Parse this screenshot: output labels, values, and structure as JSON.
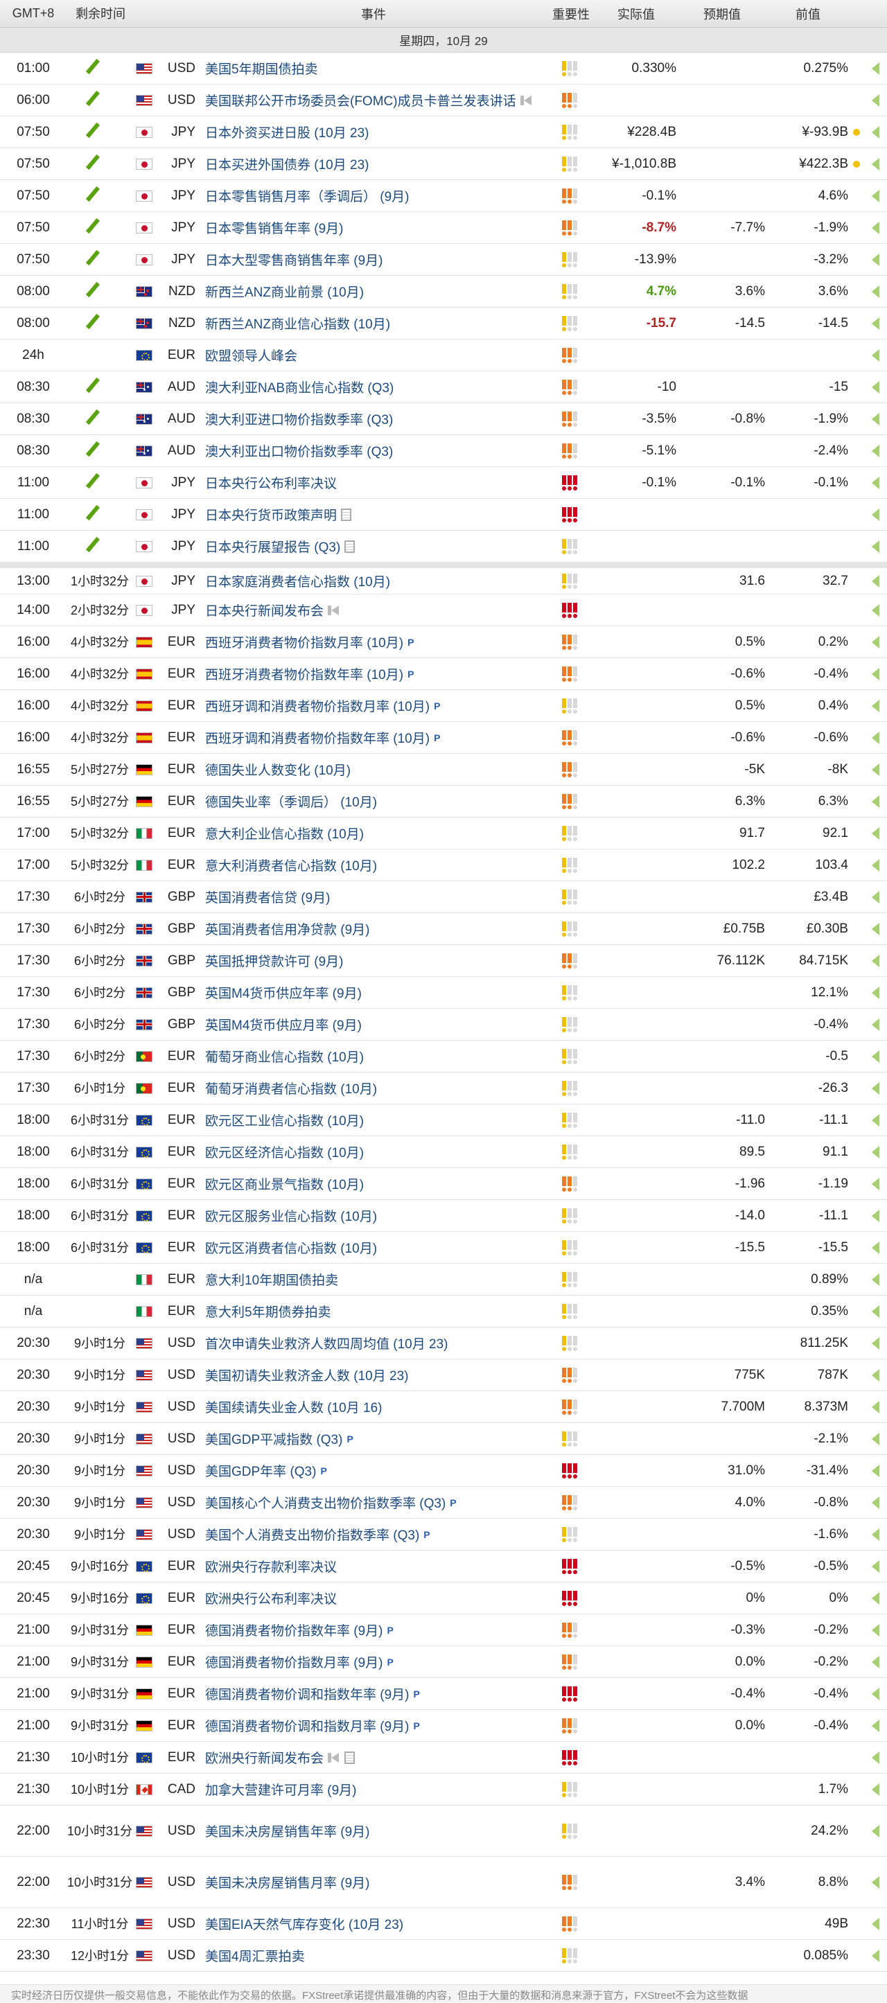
{
  "header": {
    "timezone": "GMT+8",
    "remaining": "剩余时间",
    "event": "事件",
    "importance": "重要性",
    "actual": "实际值",
    "consensus": "预期值",
    "previous": "前值"
  },
  "date_label": "星期四，10月 29",
  "importance_colors": {
    "low": "#f0c000",
    "medium": "#ef7c22",
    "high": "#d0021b",
    "off": "#d8d8d8"
  },
  "footer": "实时经济日历仅提供一般交易信息，不能依此作为交易的依据。FXStreet承诺提供最准确的内容，但由于大量的数据和消息来源于官方，FXStreet不会为这些数据",
  "rows": [
    {
      "time": "01:00",
      "rem": "",
      "done": true,
      "flag": "us",
      "cur": "USD",
      "ev": "美国5年期国债拍卖",
      "icon": "",
      "imp": 1,
      "act": "0.330%",
      "actc": "",
      "cons": "",
      "prev": "0.275%",
      "dot": false
    },
    {
      "time": "06:00",
      "rem": "",
      "done": true,
      "flag": "us",
      "cur": "USD",
      "ev": "美国联邦公开市场委员会(FOMC)成员卡普兰发表讲话",
      "icon": "mega",
      "imp": 2,
      "act": "",
      "actc": "",
      "cons": "",
      "prev": "",
      "dot": false
    },
    {
      "time": "07:50",
      "rem": "",
      "done": true,
      "flag": "jp",
      "cur": "JPY",
      "ev": "日本外资买进日股 (10月 23)",
      "icon": "",
      "imp": 1,
      "act": "¥228.4B",
      "actc": "",
      "cons": "",
      "prev": "¥-93.9B",
      "dot": true
    },
    {
      "time": "07:50",
      "rem": "",
      "done": true,
      "flag": "jp",
      "cur": "JPY",
      "ev": "日本买进外国债券 (10月 23)",
      "icon": "",
      "imp": 1,
      "act": "¥-1,010.8B",
      "actc": "",
      "cons": "",
      "prev": "¥422.3B",
      "dot": true
    },
    {
      "time": "07:50",
      "rem": "",
      "done": true,
      "flag": "jp",
      "cur": "JPY",
      "ev": "日本零售销售月率（季调后） (9月)",
      "icon": "",
      "imp": 2,
      "act": "-0.1%",
      "actc": "",
      "cons": "",
      "prev": "4.6%",
      "dot": false
    },
    {
      "time": "07:50",
      "rem": "",
      "done": true,
      "flag": "jp",
      "cur": "JPY",
      "ev": "日本零售销售年率 (9月)",
      "icon": "",
      "imp": 2,
      "act": "-8.7%",
      "actc": "neg",
      "cons": "-7.7%",
      "prev": "-1.9%",
      "dot": false
    },
    {
      "time": "07:50",
      "rem": "",
      "done": true,
      "flag": "jp",
      "cur": "JPY",
      "ev": "日本大型零售商销售年率 (9月)",
      "icon": "",
      "imp": 1,
      "act": "-13.9%",
      "actc": "",
      "cons": "",
      "prev": "-3.2%",
      "dot": false
    },
    {
      "time": "08:00",
      "rem": "",
      "done": true,
      "flag": "nz",
      "cur": "NZD",
      "ev": "新西兰ANZ商业前景 (10月)",
      "icon": "",
      "imp": 1,
      "act": "4.7%",
      "actc": "pos",
      "cons": "3.6%",
      "prev": "3.6%",
      "dot": false
    },
    {
      "time": "08:00",
      "rem": "",
      "done": true,
      "flag": "nz",
      "cur": "NZD",
      "ev": "新西兰ANZ商业信心指数 (10月)",
      "icon": "",
      "imp": 1,
      "act": "-15.7",
      "actc": "neg",
      "cons": "-14.5",
      "prev": "-14.5",
      "dot": false
    },
    {
      "time": "24h",
      "rem": "",
      "done": false,
      "flag": "eu",
      "cur": "EUR",
      "ev": "欧盟领导人峰会",
      "icon": "",
      "imp": 2,
      "act": "",
      "actc": "",
      "cons": "",
      "prev": "",
      "dot": false
    },
    {
      "time": "08:30",
      "rem": "",
      "done": true,
      "flag": "au",
      "cur": "AUD",
      "ev": "澳大利亚NAB商业信心指数 (Q3)",
      "icon": "",
      "imp": 2,
      "act": "-10",
      "actc": "",
      "cons": "",
      "prev": "-15",
      "dot": false
    },
    {
      "time": "08:30",
      "rem": "",
      "done": true,
      "flag": "au",
      "cur": "AUD",
      "ev": "澳大利亚进口物价指数季率 (Q3)",
      "icon": "",
      "imp": 2,
      "act": "-3.5%",
      "actc": "",
      "cons": "-0.8%",
      "prev": "-1.9%",
      "dot": false
    },
    {
      "time": "08:30",
      "rem": "",
      "done": true,
      "flag": "au",
      "cur": "AUD",
      "ev": "澳大利亚出口物价指数季率 (Q3)",
      "icon": "",
      "imp": 2,
      "act": "-5.1%",
      "actc": "",
      "cons": "",
      "prev": "-2.4%",
      "dot": false
    },
    {
      "time": "11:00",
      "rem": "",
      "done": true,
      "flag": "jp",
      "cur": "JPY",
      "ev": "日本央行公布利率决议",
      "icon": "",
      "imp": 3,
      "act": "-0.1%",
      "actc": "",
      "cons": "-0.1%",
      "prev": "-0.1%",
      "dot": false
    },
    {
      "time": "11:00",
      "rem": "",
      "done": true,
      "flag": "jp",
      "cur": "JPY",
      "ev": "日本央行货币政策声明",
      "icon": "doc",
      "imp": 3,
      "act": "",
      "actc": "",
      "cons": "",
      "prev": "",
      "dot": false
    },
    {
      "time": "11:00",
      "rem": "",
      "done": true,
      "flag": "jp",
      "cur": "JPY",
      "ev": "日本央行展望报告 (Q3)",
      "icon": "doc",
      "imp": 1,
      "act": "",
      "actc": "",
      "cons": "",
      "prev": "",
      "dot": false
    },
    {
      "time": "13:00",
      "rem": "1小时32分",
      "done": false,
      "flag": "jp",
      "cur": "JPY",
      "ev": "日本家庭消费者信心指数 (10月)",
      "icon": "",
      "imp": 1,
      "act": "",
      "actc": "",
      "cons": "31.6",
      "prev": "32.7",
      "dot": false,
      "sep": true
    },
    {
      "time": "14:00",
      "rem": "2小时32分",
      "done": false,
      "flag": "jp",
      "cur": "JPY",
      "ev": "日本央行新闻发布会",
      "icon": "mega",
      "imp": 3,
      "act": "",
      "actc": "",
      "cons": "",
      "prev": "",
      "dot": false
    },
    {
      "time": "16:00",
      "rem": "4小时32分",
      "done": false,
      "flag": "es",
      "cur": "EUR",
      "ev": "西班牙消费者物价指数月率 (10月)",
      "icon": "p",
      "imp": 2,
      "act": "",
      "actc": "",
      "cons": "0.5%",
      "prev": "0.2%",
      "dot": false
    },
    {
      "time": "16:00",
      "rem": "4小时32分",
      "done": false,
      "flag": "es",
      "cur": "EUR",
      "ev": "西班牙消费者物价指数年率 (10月)",
      "icon": "p",
      "imp": 2,
      "act": "",
      "actc": "",
      "cons": "-0.6%",
      "prev": "-0.4%",
      "dot": false
    },
    {
      "time": "16:00",
      "rem": "4小时32分",
      "done": false,
      "flag": "es",
      "cur": "EUR",
      "ev": "西班牙调和消费者物价指数月率 (10月)",
      "icon": "p",
      "imp": 1,
      "act": "",
      "actc": "",
      "cons": "0.5%",
      "prev": "0.4%",
      "dot": false
    },
    {
      "time": "16:00",
      "rem": "4小时32分",
      "done": false,
      "flag": "es",
      "cur": "EUR",
      "ev": "西班牙调和消费者物价指数年率 (10月)",
      "icon": "p",
      "imp": 2,
      "act": "",
      "actc": "",
      "cons": "-0.6%",
      "prev": "-0.6%",
      "dot": false
    },
    {
      "time": "16:55",
      "rem": "5小时27分",
      "done": false,
      "flag": "de",
      "cur": "EUR",
      "ev": "德国失业人数变化 (10月)",
      "icon": "",
      "imp": 2,
      "act": "",
      "actc": "",
      "cons": "-5K",
      "prev": "-8K",
      "dot": false
    },
    {
      "time": "16:55",
      "rem": "5小时27分",
      "done": false,
      "flag": "de",
      "cur": "EUR",
      "ev": "德国失业率（季调后） (10月)",
      "icon": "",
      "imp": 2,
      "act": "",
      "actc": "",
      "cons": "6.3%",
      "prev": "6.3%",
      "dot": false
    },
    {
      "time": "17:00",
      "rem": "5小时32分",
      "done": false,
      "flag": "it",
      "cur": "EUR",
      "ev": "意大利企业信心指数 (10月)",
      "icon": "",
      "imp": 1,
      "act": "",
      "actc": "",
      "cons": "91.7",
      "prev": "92.1",
      "dot": false
    },
    {
      "time": "17:00",
      "rem": "5小时32分",
      "done": false,
      "flag": "it",
      "cur": "EUR",
      "ev": "意大利消费者信心指数 (10月)",
      "icon": "",
      "imp": 1,
      "act": "",
      "actc": "",
      "cons": "102.2",
      "prev": "103.4",
      "dot": false
    },
    {
      "time": "17:30",
      "rem": "6小时2分",
      "done": false,
      "flag": "gb",
      "cur": "GBP",
      "ev": "英国消费者信贷 (9月)",
      "icon": "",
      "imp": 1,
      "act": "",
      "actc": "",
      "cons": "",
      "prev": "£3.4B",
      "dot": false
    },
    {
      "time": "17:30",
      "rem": "6小时2分",
      "done": false,
      "flag": "gb",
      "cur": "GBP",
      "ev": "英国消费者信用净贷款 (9月)",
      "icon": "",
      "imp": 1,
      "act": "",
      "actc": "",
      "cons": "£0.75B",
      "prev": "£0.30B",
      "dot": false
    },
    {
      "time": "17:30",
      "rem": "6小时2分",
      "done": false,
      "flag": "gb",
      "cur": "GBP",
      "ev": "英国抵押贷款许可 (9月)",
      "icon": "",
      "imp": 2,
      "act": "",
      "actc": "",
      "cons": "76.112K",
      "prev": "84.715K",
      "dot": false
    },
    {
      "time": "17:30",
      "rem": "6小时2分",
      "done": false,
      "flag": "gb",
      "cur": "GBP",
      "ev": "英国M4货币供应年率 (9月)",
      "icon": "",
      "imp": 1,
      "act": "",
      "actc": "",
      "cons": "",
      "prev": "12.1%",
      "dot": false
    },
    {
      "time": "17:30",
      "rem": "6小时2分",
      "done": false,
      "flag": "gb",
      "cur": "GBP",
      "ev": "英国M4货币供应月率 (9月)",
      "icon": "",
      "imp": 1,
      "act": "",
      "actc": "",
      "cons": "",
      "prev": "-0.4%",
      "dot": false
    },
    {
      "time": "17:30",
      "rem": "6小时2分",
      "done": false,
      "flag": "pt",
      "cur": "EUR",
      "ev": "葡萄牙商业信心指数 (10月)",
      "icon": "",
      "imp": 1,
      "act": "",
      "actc": "",
      "cons": "",
      "prev": "-0.5",
      "dot": false
    },
    {
      "time": "17:30",
      "rem": "6小时1分",
      "done": false,
      "flag": "pt",
      "cur": "EUR",
      "ev": "葡萄牙消费者信心指数 (10月)",
      "icon": "",
      "imp": 1,
      "act": "",
      "actc": "",
      "cons": "",
      "prev": "-26.3",
      "dot": false
    },
    {
      "time": "18:00",
      "rem": "6小时31分",
      "done": false,
      "flag": "eu",
      "cur": "EUR",
      "ev": "欧元区工业信心指数 (10月)",
      "icon": "",
      "imp": 1,
      "act": "",
      "actc": "",
      "cons": "-11.0",
      "prev": "-11.1",
      "dot": false
    },
    {
      "time": "18:00",
      "rem": "6小时31分",
      "done": false,
      "flag": "eu",
      "cur": "EUR",
      "ev": "欧元区经济信心指数 (10月)",
      "icon": "",
      "imp": 1,
      "act": "",
      "actc": "",
      "cons": "89.5",
      "prev": "91.1",
      "dot": false
    },
    {
      "time": "18:00",
      "rem": "6小时31分",
      "done": false,
      "flag": "eu",
      "cur": "EUR",
      "ev": "欧元区商业景气指数 (10月)",
      "icon": "",
      "imp": 2,
      "act": "",
      "actc": "",
      "cons": "-1.96",
      "prev": "-1.19",
      "dot": false
    },
    {
      "time": "18:00",
      "rem": "6小时31分",
      "done": false,
      "flag": "eu",
      "cur": "EUR",
      "ev": "欧元区服务业信心指数 (10月)",
      "icon": "",
      "imp": 1,
      "act": "",
      "actc": "",
      "cons": "-14.0",
      "prev": "-11.1",
      "dot": false
    },
    {
      "time": "18:00",
      "rem": "6小时31分",
      "done": false,
      "flag": "eu",
      "cur": "EUR",
      "ev": "欧元区消费者信心指数 (10月)",
      "icon": "",
      "imp": 1,
      "act": "",
      "actc": "",
      "cons": "-15.5",
      "prev": "-15.5",
      "dot": false
    },
    {
      "time": "n/a",
      "rem": "",
      "done": false,
      "flag": "it",
      "cur": "EUR",
      "ev": "意大利10年期国债拍卖",
      "icon": "",
      "imp": 1,
      "act": "",
      "actc": "",
      "cons": "",
      "prev": "0.89%",
      "dot": false
    },
    {
      "time": "n/a",
      "rem": "",
      "done": false,
      "flag": "it",
      "cur": "EUR",
      "ev": "意大利5年期债券拍卖",
      "icon": "",
      "imp": 1,
      "act": "",
      "actc": "",
      "cons": "",
      "prev": "0.35%",
      "dot": false
    },
    {
      "time": "20:30",
      "rem": "9小时1分",
      "done": false,
      "flag": "us",
      "cur": "USD",
      "ev": "首次申请失业救济人数四周均值 (10月 23)",
      "icon": "",
      "imp": 1,
      "act": "",
      "actc": "",
      "cons": "",
      "prev": "811.25K",
      "dot": false
    },
    {
      "time": "20:30",
      "rem": "9小时1分",
      "done": false,
      "flag": "us",
      "cur": "USD",
      "ev": "美国初请失业救济金人数 (10月 23)",
      "icon": "",
      "imp": 2,
      "act": "",
      "actc": "",
      "cons": "775K",
      "prev": "787K",
      "dot": false
    },
    {
      "time": "20:30",
      "rem": "9小时1分",
      "done": false,
      "flag": "us",
      "cur": "USD",
      "ev": "美国续请失业金人数 (10月 16)",
      "icon": "",
      "imp": 2,
      "act": "",
      "actc": "",
      "cons": "7.700M",
      "prev": "8.373M",
      "dot": false
    },
    {
      "time": "20:30",
      "rem": "9小时1分",
      "done": false,
      "flag": "us",
      "cur": "USD",
      "ev": "美国GDP平减指数 (Q3)",
      "icon": "p",
      "imp": 1,
      "act": "",
      "actc": "",
      "cons": "",
      "prev": "-2.1%",
      "dot": false
    },
    {
      "time": "20:30",
      "rem": "9小时1分",
      "done": false,
      "flag": "us",
      "cur": "USD",
      "ev": "美国GDP年率 (Q3)",
      "icon": "p",
      "imp": 3,
      "act": "",
      "actc": "",
      "cons": "31.0%",
      "prev": "-31.4%",
      "dot": false
    },
    {
      "time": "20:30",
      "rem": "9小时1分",
      "done": false,
      "flag": "us",
      "cur": "USD",
      "ev": "美国核心个人消费支出物价指数季率 (Q3)",
      "icon": "p",
      "imp": 2,
      "act": "",
      "actc": "",
      "cons": "4.0%",
      "prev": "-0.8%",
      "dot": false
    },
    {
      "time": "20:30",
      "rem": "9小时1分",
      "done": false,
      "flag": "us",
      "cur": "USD",
      "ev": "美国个人消费支出物价指数季率 (Q3)",
      "icon": "p",
      "imp": 1,
      "act": "",
      "actc": "",
      "cons": "",
      "prev": "-1.6%",
      "dot": false
    },
    {
      "time": "20:45",
      "rem": "9小时16分",
      "done": false,
      "flag": "eu",
      "cur": "EUR",
      "ev": "欧洲央行存款利率决议",
      "icon": "",
      "imp": 3,
      "act": "",
      "actc": "",
      "cons": "-0.5%",
      "prev": "-0.5%",
      "dot": false
    },
    {
      "time": "20:45",
      "rem": "9小时16分",
      "done": false,
      "flag": "eu",
      "cur": "EUR",
      "ev": "欧洲央行公布利率决议",
      "icon": "",
      "imp": 3,
      "act": "",
      "actc": "",
      "cons": "0%",
      "prev": "0%",
      "dot": false
    },
    {
      "time": "21:00",
      "rem": "9小时31分",
      "done": false,
      "flag": "de",
      "cur": "EUR",
      "ev": "德国消费者物价指数年率 (9月)",
      "icon": "p",
      "imp": 2,
      "act": "",
      "actc": "",
      "cons": "-0.3%",
      "prev": "-0.2%",
      "dot": false
    },
    {
      "time": "21:00",
      "rem": "9小时31分",
      "done": false,
      "flag": "de",
      "cur": "EUR",
      "ev": "德国消费者物价指数月率 (9月)",
      "icon": "p",
      "imp": 2,
      "act": "",
      "actc": "",
      "cons": "0.0%",
      "prev": "-0.2%",
      "dot": false
    },
    {
      "time": "21:00",
      "rem": "9小时31分",
      "done": false,
      "flag": "de",
      "cur": "EUR",
      "ev": "德国消费者物价调和指数年率 (9月)",
      "icon": "p",
      "imp": 3,
      "act": "",
      "actc": "",
      "cons": "-0.4%",
      "prev": "-0.4%",
      "dot": false
    },
    {
      "time": "21:00",
      "rem": "9小时31分",
      "done": false,
      "flag": "de",
      "cur": "EUR",
      "ev": "德国消费者物价调和指数月率 (9月)",
      "icon": "p",
      "imp": 2,
      "act": "",
      "actc": "",
      "cons": "0.0%",
      "prev": "-0.4%",
      "dot": false
    },
    {
      "time": "21:30",
      "rem": "10小时1分",
      "done": false,
      "flag": "eu",
      "cur": "EUR",
      "ev": "欧洲央行新闻发布会",
      "icon": "megadoc",
      "imp": 3,
      "act": "",
      "actc": "",
      "cons": "",
      "prev": "",
      "dot": false
    },
    {
      "time": "21:30",
      "rem": "10小时1分",
      "done": false,
      "flag": "ca",
      "cur": "CAD",
      "ev": "加拿大营建许可月率 (9月)",
      "icon": "",
      "imp": 1,
      "act": "",
      "actc": "",
      "cons": "",
      "prev": "1.7%",
      "dot": false
    },
    {
      "time": "22:00",
      "rem": "10小时31分",
      "done": false,
      "flag": "us",
      "cur": "USD",
      "ev": "美国未决房屋销售年率 (9月)",
      "icon": "",
      "imp": 1,
      "act": "",
      "actc": "",
      "cons": "",
      "prev": "24.2%",
      "dot": false,
      "tall": true
    },
    {
      "time": "22:00",
      "rem": "10小时31分",
      "done": false,
      "flag": "us",
      "cur": "USD",
      "ev": "美国未决房屋销售月率 (9月)",
      "icon": "",
      "imp": 2,
      "act": "",
      "actc": "",
      "cons": "3.4%",
      "prev": "8.8%",
      "dot": false,
      "tall": true
    },
    {
      "time": "22:30",
      "rem": "11小时1分",
      "done": false,
      "flag": "us",
      "cur": "USD",
      "ev": "美国EIA天然气库存变化 (10月 23)",
      "icon": "",
      "imp": 2,
      "act": "",
      "actc": "",
      "cons": "",
      "prev": "49B",
      "dot": false
    },
    {
      "time": "23:30",
      "rem": "12小时1分",
      "done": false,
      "flag": "us",
      "cur": "USD",
      "ev": "美国4周汇票拍卖",
      "icon": "",
      "imp": 1,
      "act": "",
      "actc": "",
      "cons": "",
      "prev": "0.085%",
      "dot": false
    }
  ]
}
